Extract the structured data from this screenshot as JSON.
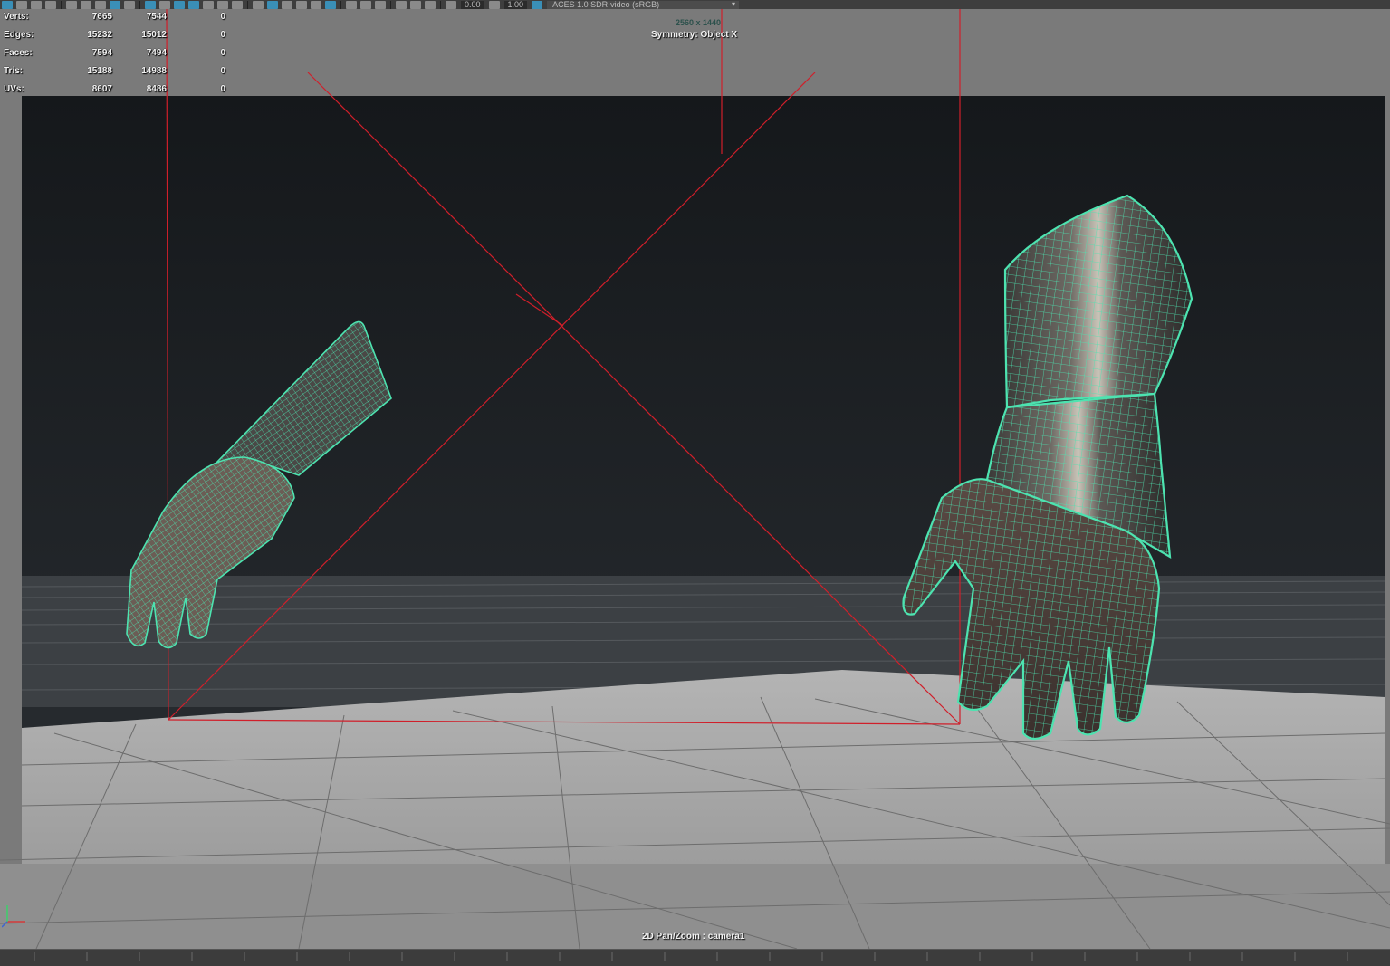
{
  "toolbar": {
    "field_a": "0.00",
    "field_b": "1.00",
    "color_management": "ACES 1.0 SDR-video (sRGB)"
  },
  "hud": {
    "stats": [
      {
        "label": "Verts:",
        "total": "7665",
        "selected": "7544",
        "components": "0"
      },
      {
        "label": "Edges:",
        "total": "15232",
        "selected": "15012",
        "components": "0"
      },
      {
        "label": "Faces:",
        "total": "7594",
        "selected": "7494",
        "components": "0"
      },
      {
        "label": "Tris:",
        "total": "15188",
        "selected": "14988",
        "components": "0"
      },
      {
        "label": "UVs:",
        "total": "8607",
        "selected": "8486",
        "components": "0"
      }
    ],
    "resolution": "2560 x 1440",
    "symmetry": "Symmetry: Object X",
    "camera": "2D Pan/Zoom : camera1"
  },
  "colors": {
    "wireframe": "#4de3b0",
    "camera_frustum": "#d01f2a",
    "backdrop_dark": "#1c1f22",
    "floor": "#9a9a9a"
  }
}
